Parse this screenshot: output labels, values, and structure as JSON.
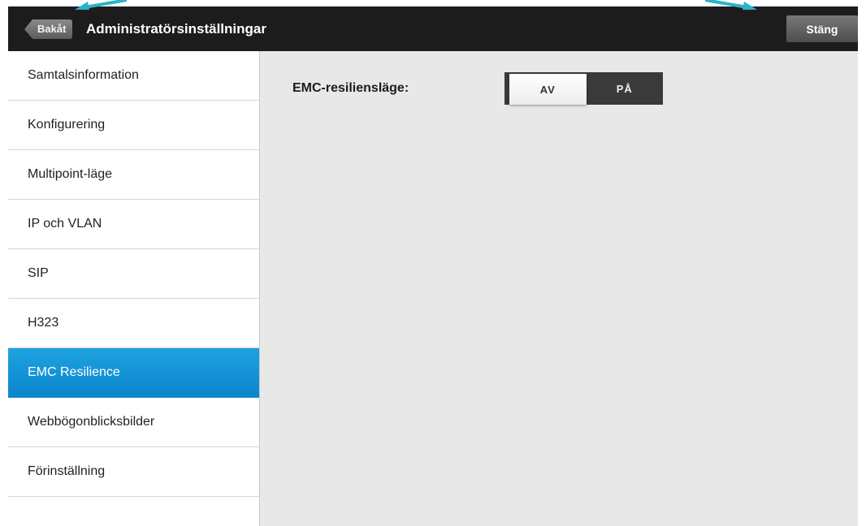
{
  "header": {
    "back_label": "Bakåt",
    "title": "Administratörsinställningar",
    "close_label": "Stäng"
  },
  "sidebar": {
    "items": [
      {
        "label": "Samtalsinformation",
        "active": false
      },
      {
        "label": "Konfigurering",
        "active": false
      },
      {
        "label": "Multipoint-läge",
        "active": false
      },
      {
        "label": "IP och VLAN",
        "active": false
      },
      {
        "label": "SIP",
        "active": false
      },
      {
        "label": "H323",
        "active": false
      },
      {
        "label": "EMC Resilience",
        "active": true
      },
      {
        "label": "Webbögonblicksbilder",
        "active": false
      },
      {
        "label": "Förinställning",
        "active": false
      },
      {
        "label": "",
        "active": false
      }
    ]
  },
  "main": {
    "setting_label": "EMC-resiliensläge:",
    "toggle": {
      "off_label": "AV",
      "on_label": "PÅ",
      "selected": "AV"
    }
  },
  "colors": {
    "active_item": "#1598d8",
    "topbar": "#1c1c1c",
    "content_bg": "#e8e8e8",
    "annotation_arrow": "#2bb3c9"
  },
  "annotations": {
    "arrows": [
      "arrow-to-back-button",
      "arrow-to-close-button"
    ]
  }
}
